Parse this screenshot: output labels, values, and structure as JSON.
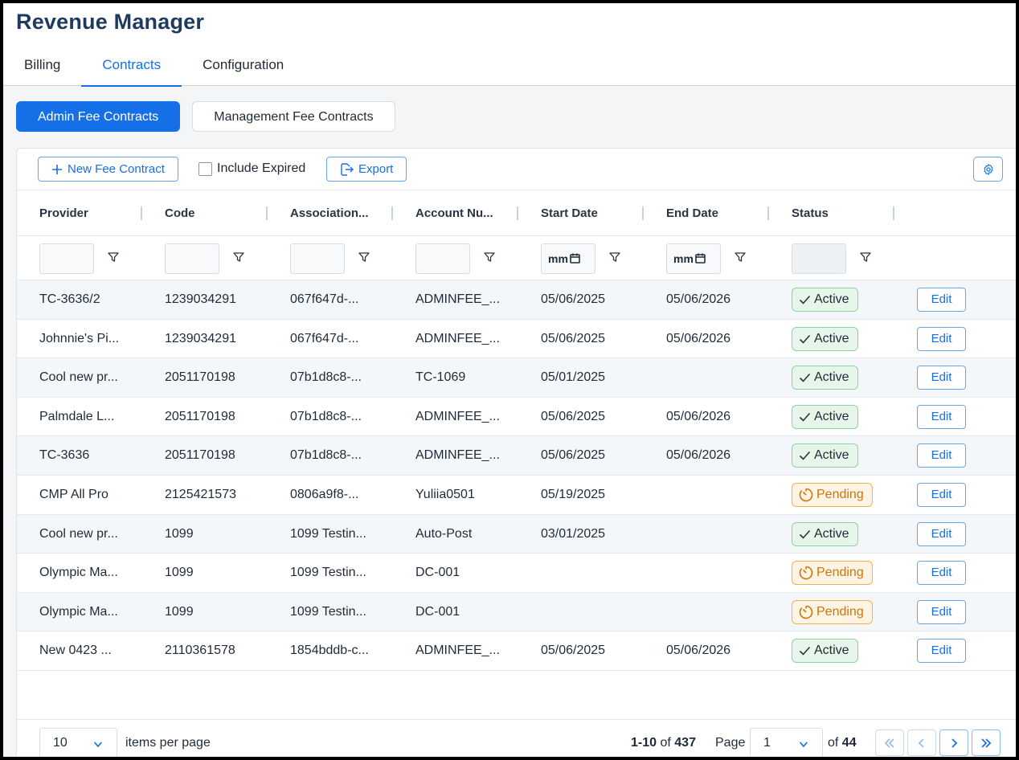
{
  "app": {
    "title": "Revenue Manager"
  },
  "nav": {
    "tabs": [
      {
        "label": "Billing"
      },
      {
        "label": "Contracts"
      },
      {
        "label": "Configuration"
      }
    ],
    "active": "Contracts"
  },
  "subtabs": [
    {
      "label": "Admin Fee Contracts"
    },
    {
      "label": "Management Fee Contracts"
    }
  ],
  "toolbar": {
    "new_label": "New Fee Contract",
    "include_expired_label": "Include Expired",
    "include_expired_checked": false,
    "export_label": "Export"
  },
  "columns": [
    "Provider",
    "Code",
    "Association...",
    "Account Nu...",
    "Start Date",
    "End Date",
    "Status"
  ],
  "filters": {
    "start_date_value": "mm",
    "end_date_value": "mm"
  },
  "rows": [
    {
      "provider": "TC-3636/2",
      "code": "1239034291",
      "association": "067f647d-...",
      "account": "ADMINFEE_...",
      "start": "05/06/2025",
      "end": "05/06/2026",
      "status": "Active",
      "edit": "Edit"
    },
    {
      "provider": "Johnnie's Pi...",
      "code": "1239034291",
      "association": "067f647d-...",
      "account": "ADMINFEE_...",
      "start": "05/06/2025",
      "end": "05/06/2026",
      "status": "Active",
      "edit": "Edit"
    },
    {
      "provider": "Cool new pr...",
      "code": "2051170198",
      "association": "07b1d8c8-...",
      "account": "TC-1069",
      "start": "05/01/2025",
      "end": "",
      "status": "Active",
      "edit": "Edit"
    },
    {
      "provider": "Palmdale L...",
      "code": "2051170198",
      "association": "07b1d8c8-...",
      "account": "ADMINFEE_...",
      "start": "05/06/2025",
      "end": "05/06/2026",
      "status": "Active",
      "edit": "Edit"
    },
    {
      "provider": "TC-3636",
      "code": "2051170198",
      "association": "07b1d8c8-...",
      "account": "ADMINFEE_...",
      "start": "05/06/2025",
      "end": "05/06/2026",
      "status": "Active",
      "edit": "Edit"
    },
    {
      "provider": "CMP All Pro",
      "code": "2125421573",
      "association": "0806a9f8-...",
      "account": "Yuliia0501",
      "start": "05/19/2025",
      "end": "",
      "status": "Pending",
      "edit": "Edit"
    },
    {
      "provider": "Cool new pr...",
      "code": "1099",
      "association": "1099 Testin...",
      "account": "Auto-Post",
      "start": "03/01/2025",
      "end": "",
      "status": "Active",
      "edit": "Edit"
    },
    {
      "provider": "Olympic Ma...",
      "code": "1099",
      "association": "1099 Testin...",
      "account": "DC-001",
      "start": "",
      "end": "",
      "status": "Pending",
      "edit": "Edit"
    },
    {
      "provider": "Olympic Ma...",
      "code": "1099",
      "association": "1099 Testin...",
      "account": "DC-001",
      "start": "",
      "end": "",
      "status": "Pending",
      "edit": "Edit"
    },
    {
      "provider": "New 0423 ...",
      "code": "2110361578",
      "association": "1854bddb-c...",
      "account": "ADMINFEE_...",
      "start": "05/06/2025",
      "end": "05/06/2026",
      "status": "Active",
      "edit": "Edit"
    }
  ],
  "pager": {
    "page_size": "10",
    "items_per_page_label": "items per page",
    "range": "1-10",
    "of_word": "of",
    "total": "437",
    "page_label": "Page",
    "current_page": "1",
    "of_pages_word": "of",
    "total_pages": "44"
  },
  "colors": {
    "accent": "#1570e8",
    "active_bg": "#e6f6ea",
    "pending_fg": "#c9770b"
  }
}
